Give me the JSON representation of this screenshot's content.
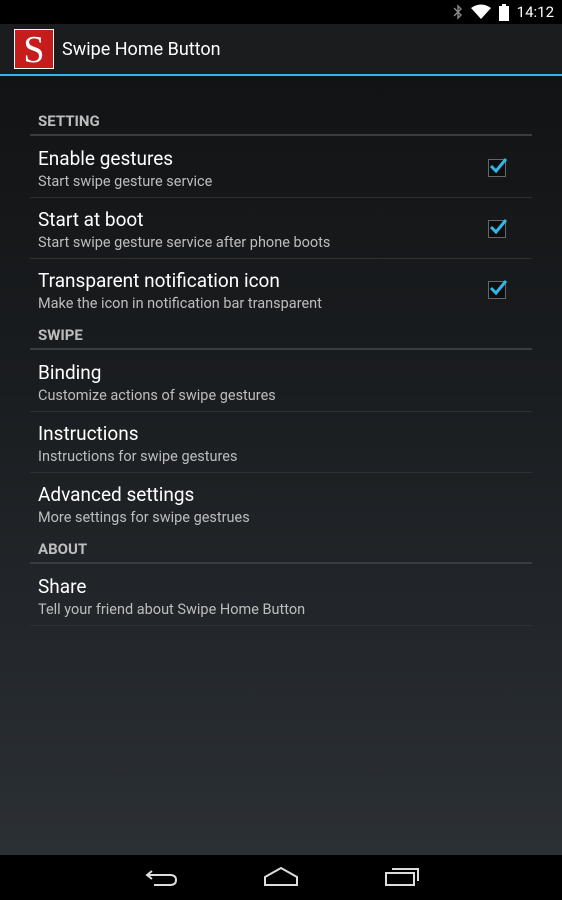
{
  "status_bar": {
    "time": "14:12",
    "icons": [
      "bluetooth-icon",
      "wifi-icon",
      "battery-icon"
    ]
  },
  "action_bar": {
    "logo_letter": "S",
    "title": "Swipe Home Button",
    "accent_color": "#33b5e5"
  },
  "sections": [
    {
      "header": "SETTING",
      "items": [
        {
          "title": "Enable gestures",
          "summary": "Start swipe gesture service",
          "checked": true
        },
        {
          "title": "Start at boot",
          "summary": "Start swipe gesture service after phone boots",
          "checked": true
        },
        {
          "title": "Transparent notification icon",
          "summary": "Make the icon in notification bar transparent",
          "checked": true
        }
      ]
    },
    {
      "header": "SWIPE",
      "items": [
        {
          "title": "Binding",
          "summary": "Customize actions of swipe gestures"
        },
        {
          "title": "Instructions",
          "summary": "Instructions for swipe gestures"
        },
        {
          "title": "Advanced settings",
          "summary": "More settings for swipe gestrues"
        }
      ]
    },
    {
      "header": "ABOUT",
      "items": [
        {
          "title": "Share",
          "summary": "Tell your friend about Swipe Home Button"
        }
      ]
    }
  ],
  "nav_bar": {
    "buttons": [
      "back-icon",
      "home-icon",
      "recent-apps-icon"
    ]
  }
}
